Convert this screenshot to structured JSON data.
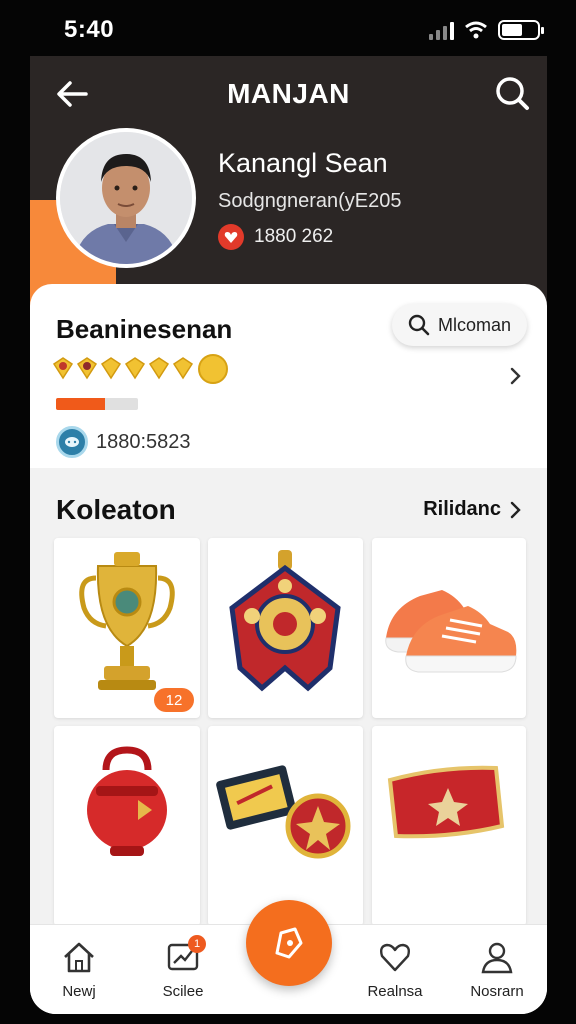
{
  "status": {
    "time": "5:40"
  },
  "header": {
    "title": "MANJAN",
    "icons": [
      "back-arrow-icon",
      "search-icon"
    ]
  },
  "profile": {
    "name": "Kanangl Sean",
    "handle": "Sodgngneran(yE205",
    "count": "1880 262"
  },
  "card": {
    "title": "Beaninesenan",
    "pill_label": "Mlcoman",
    "progress_fraction": 0.6,
    "id_text": "1880:5823"
  },
  "collection": {
    "title": "Koleaton",
    "link": "Rilidanc",
    "items": [
      {
        "label": "trophy",
        "badge": "12"
      },
      {
        "label": "banner"
      },
      {
        "label": "sneakers"
      },
      {
        "label": "red-pot"
      },
      {
        "label": "plaque-medal"
      },
      {
        "label": "red-case"
      }
    ]
  },
  "tabs": [
    {
      "label": "Newj",
      "icon": "home-icon"
    },
    {
      "label": "Scilee",
      "icon": "chart-icon",
      "badge": "1"
    },
    {
      "label": "Realnsa",
      "icon": "heart-icon"
    },
    {
      "label": "Nosrarn",
      "icon": "user-icon"
    }
  ],
  "colors": {
    "accent": "#f46e1e",
    "hero": "#2b2625"
  }
}
